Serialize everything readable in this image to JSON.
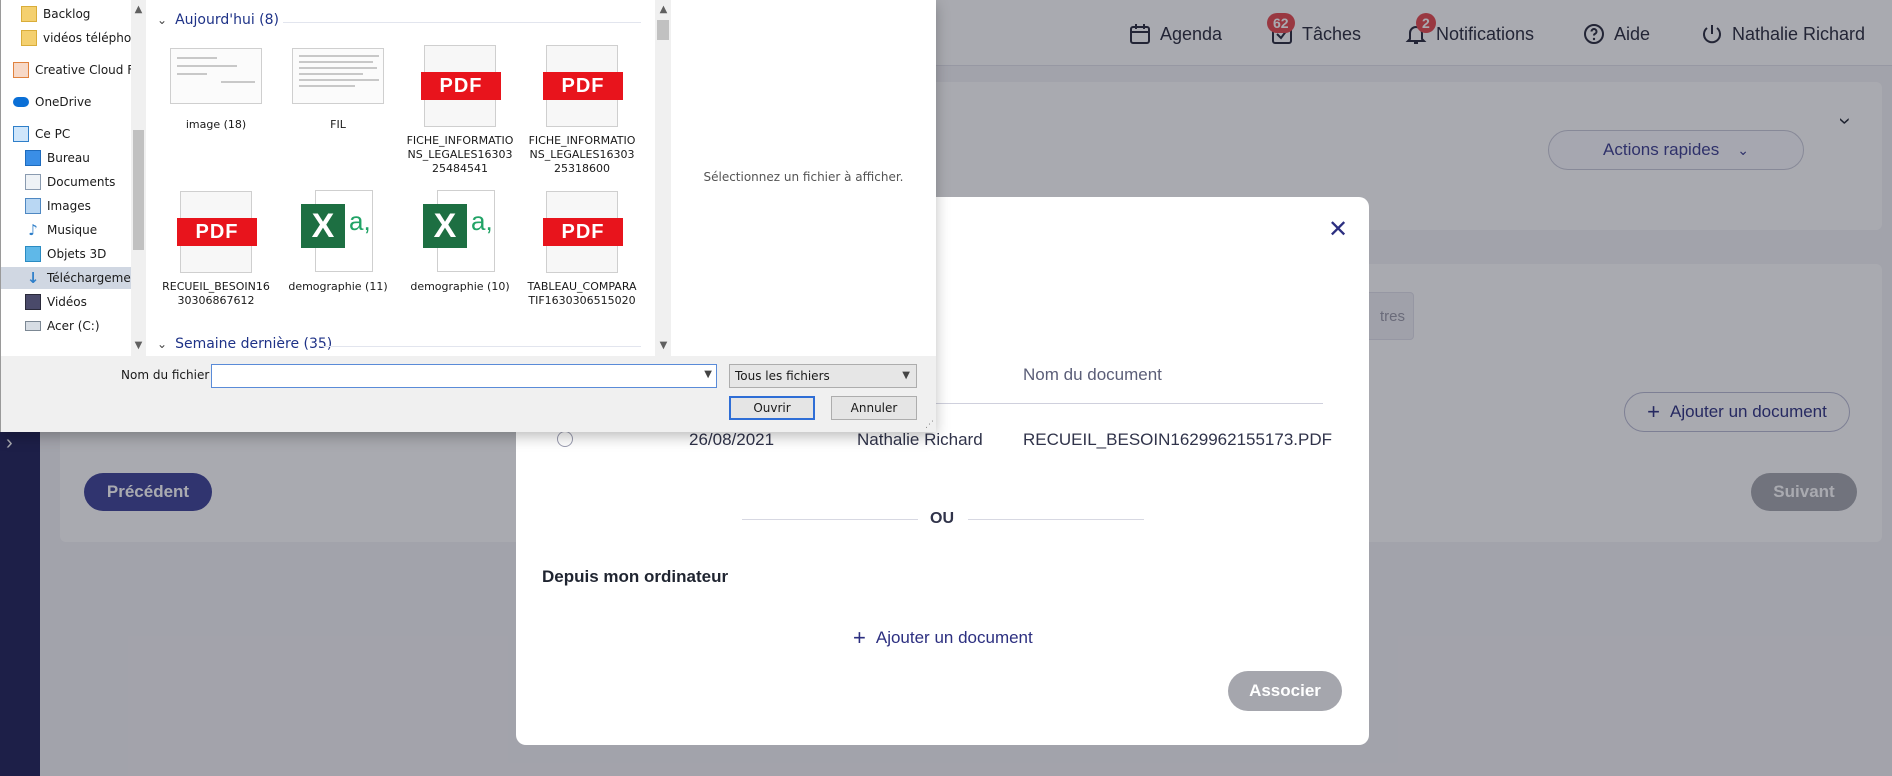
{
  "topbar": {
    "agenda": "Agenda",
    "taches": "Tâches",
    "taches_count": "62",
    "notifications": "Notifications",
    "notifications_count": "2",
    "aide": "Aide",
    "user": "Nathalie Richard"
  },
  "main": {
    "quick_actions": "Actions rapides",
    "autres": "tres",
    "add_document": "Ajouter un document",
    "previous": "Précédent",
    "next": "Suivant"
  },
  "modal": {
    "column_name": "Nom du document",
    "row": {
      "date": "26/08/2021",
      "author": "Nathalie Richard",
      "name": "RECUEIL_BESOIN1629962155173.PDF"
    },
    "or": "OU",
    "from_computer": "Depuis mon ordinateur",
    "add_document": "Ajouter un document",
    "associate": "Associer"
  },
  "file_dialog": {
    "nav_items": [
      {
        "label": "Backlog",
        "icon": "folder-icon"
      },
      {
        "label": "vidéos téléphone",
        "icon": "folder-icon"
      },
      {
        "label": "Creative Cloud Fil",
        "icon": "creative-cloud-icon"
      },
      {
        "label": "OneDrive",
        "icon": "onedrive-icon"
      },
      {
        "label": "Ce PC",
        "icon": "computer-icon"
      },
      {
        "label": "Bureau",
        "icon": "desktop-icon"
      },
      {
        "label": "Documents",
        "icon": "documents-icon"
      },
      {
        "label": "Images",
        "icon": "images-icon"
      },
      {
        "label": "Musique",
        "icon": "music-icon"
      },
      {
        "label": "Objets 3D",
        "icon": "cube-icon"
      },
      {
        "label": "Téléchargements",
        "icon": "download-icon"
      },
      {
        "label": "Vidéos",
        "icon": "video-icon"
      },
      {
        "label": "Acer (C:)",
        "icon": "drive-icon"
      }
    ],
    "group_today": "Aujourd'hui (8)",
    "group_last_week": "Semaine dernière (35)",
    "files": [
      {
        "name": "image (18)",
        "kind": "image"
      },
      {
        "name": "FIL",
        "kind": "image"
      },
      {
        "name": "FICHE_INFORMATIONS_LEGALES1630325484541",
        "kind": "pdf"
      },
      {
        "name": "FICHE_INFORMATIONS_LEGALES1630325318600",
        "kind": "pdf"
      },
      {
        "name": "RECUEIL_BESOIN1630306867612",
        "kind": "pdf"
      },
      {
        "name": "demographie (11)",
        "kind": "xlsx"
      },
      {
        "name": "demographie (10)",
        "kind": "xlsx"
      },
      {
        "name": "TABLEAU_COMPARATIF1630306515020",
        "kind": "pdf"
      }
    ],
    "pdf_badge": "PDF",
    "xls_letter": "X",
    "xls_glyph": "a,",
    "preview_text": "Sélectionnez un fichier à afficher.",
    "filename_label": "Nom du fichier :",
    "filename_value": "",
    "file_type": "Tous les fichiers",
    "open": "Ouvrir",
    "cancel": "Annuler"
  },
  "colors": {
    "rail": "#1e1f57",
    "primary": "#3d4196",
    "disabled": "#a5a6ad",
    "badge": "#e5484d",
    "pdf_red": "#e8141c",
    "excel_green": "#1d6f42",
    "link_blue": "#1e3287"
  }
}
